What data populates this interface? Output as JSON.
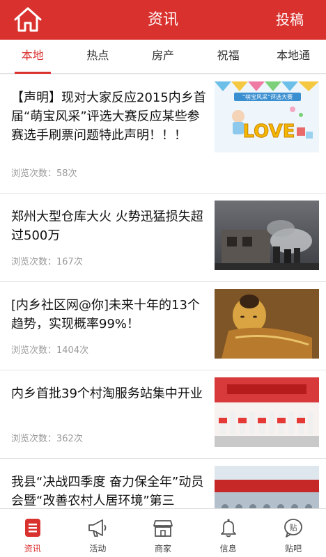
{
  "header": {
    "title": "资讯",
    "post_label": "投稿"
  },
  "tabs": [
    {
      "label": "本地",
      "active": true
    },
    {
      "label": "热点"
    },
    {
      "label": "房产"
    },
    {
      "label": "祝福"
    },
    {
      "label": "本地通"
    }
  ],
  "feed": [
    {
      "title": "【声明】现对大家反应2015内乡首届“萌宝风采”评选大赛反应某些参赛选手刷票问题特此声明！！！",
      "views": "浏览次数：58次"
    },
    {
      "title": "郑州大型仓库大火 火势迅猛损失超过500万",
      "views": "浏览次数：167次"
    },
    {
      "title": "[内乡社区网@你]未来十年的13个趋势，实现概率99%！",
      "views": "浏览次数：1404次"
    },
    {
      "title": "内乡首批39个村淘服务站集中开业",
      "views": "浏览次数：362次"
    },
    {
      "title": "我县“决战四季度 奋力保全年”动员会暨“改善农村人居环境”第三",
      "views": ""
    }
  ],
  "tabbar": [
    {
      "label": "资讯",
      "icon": "news-icon",
      "active": true
    },
    {
      "label": "活动",
      "icon": "megaphone-icon"
    },
    {
      "label": "商家",
      "icon": "shop-icon"
    },
    {
      "label": "信息",
      "icon": "bell-icon"
    },
    {
      "label": "贴吧",
      "icon": "forum-icon",
      "icon_text": "贴"
    }
  ],
  "thumb_texts": {
    "love": "LOVE",
    "banner": "“萌宝风采”评选大赛"
  },
  "colors": {
    "brand": "#d9312e",
    "muted": "#9a9a9a"
  }
}
